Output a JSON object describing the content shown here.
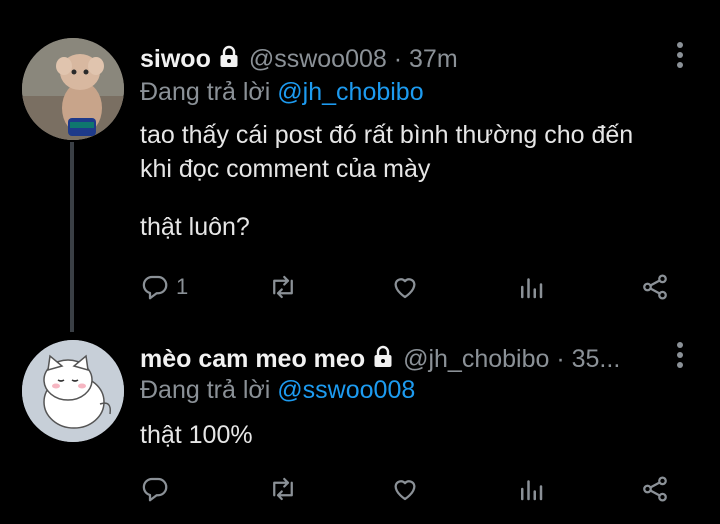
{
  "tweets": [
    {
      "display_name": "siwoo",
      "handle_time": "@sswoo008 · 37m",
      "reply_prefix": "Đang trả lời",
      "reply_to": "@jh_chobibo",
      "lines": [
        "tao thấy cái post đó rất bình thường cho đến",
        "khi đọc comment của mày",
        "",
        "thật luôn?"
      ],
      "reply_count": "1"
    },
    {
      "display_name": "mèo cam meo meo",
      "handle_time": "@jh_chobibo · 35...",
      "reply_prefix": "Đang trả lời",
      "reply_to": "@sswoo008",
      "lines": [
        "thật 100%"
      ],
      "reply_count": ""
    }
  ],
  "icons": {
    "lock": "lock-icon",
    "more": "more-vertical-icon",
    "reply": "reply-icon",
    "retweet": "retweet-icon",
    "like": "heart-icon",
    "analytics": "analytics-icon",
    "share": "share-icon"
  },
  "colors": {
    "background": "#000000",
    "mention": "#1d9bf0",
    "muted": "#8b9197"
  }
}
